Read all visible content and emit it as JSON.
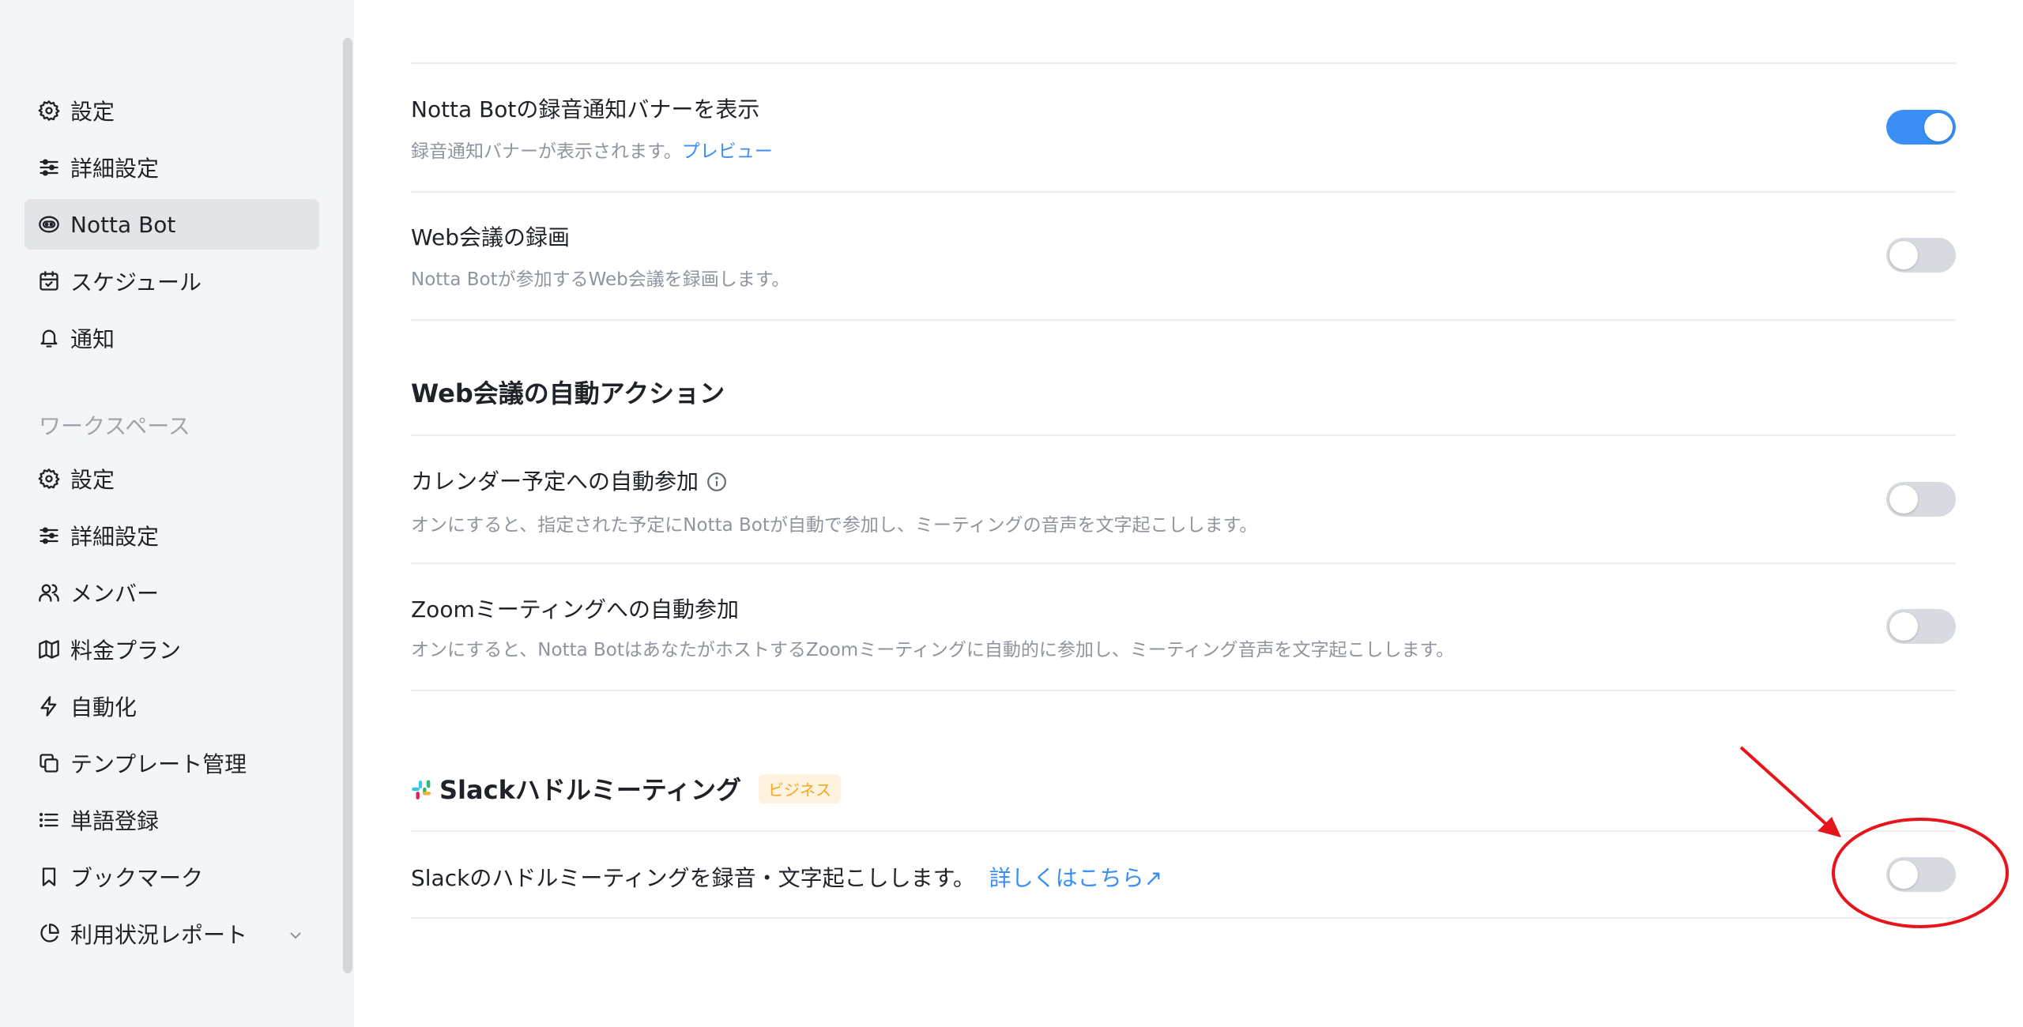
{
  "sidebar": {
    "personal_items": [
      {
        "label": "設定",
        "icon": "gear-icon"
      },
      {
        "label": "詳細設定",
        "icon": "sliders-icon"
      },
      {
        "label": "Notta Bot",
        "icon": "bot-icon",
        "active": true
      },
      {
        "label": "スケジュール",
        "icon": "calendar-icon"
      },
      {
        "label": "通知",
        "icon": "bell-icon"
      }
    ],
    "workspace_label": "ワークスペース",
    "workspace_items": [
      {
        "label": "設定",
        "icon": "gear-icon"
      },
      {
        "label": "詳細設定",
        "icon": "sliders-icon"
      },
      {
        "label": "メンバー",
        "icon": "users-icon"
      },
      {
        "label": "料金プラン",
        "icon": "map-icon"
      },
      {
        "label": "自動化",
        "icon": "lightning-icon"
      },
      {
        "label": "テンプレート管理",
        "icon": "copy-icon"
      },
      {
        "label": "単語登録",
        "icon": "list-icon"
      },
      {
        "label": "ブックマーク",
        "icon": "bookmark-icon"
      },
      {
        "label": "利用状況レポート",
        "icon": "pie-chart-icon",
        "expandable": true
      }
    ]
  },
  "main": {
    "banner_setting": {
      "title": "Notta Botの録音通知バナーを表示",
      "desc": "録音通知バナーが表示されます。",
      "link": "プレビュー",
      "enabled": true
    },
    "video_recording": {
      "title": "Web会議の録画",
      "desc": "Notta Botが参加するWeb会議を録画します。",
      "enabled": false
    },
    "auto_actions_title": "Web会議の自動アクション",
    "calendar_join": {
      "title": "カレンダー予定への自動参加",
      "desc": "オンにすると、指定された予定にNotta Botが自動で参加し、ミーティングの音声を文字起こしします。",
      "enabled": false
    },
    "zoom_join": {
      "title": "Zoomミーティングへの自動参加",
      "desc": "オンにすると、Notta BotはあなたがホストするZoomミーティングに自動的に参加し、ミーティング音声を文字起こしします。",
      "enabled": false
    },
    "slack": {
      "title": "Slackハドルミーティング",
      "badge": "ビジネス",
      "desc": "Slackのハドルミーティングを録音・文字起こしします。",
      "link": "詳しくはこちら↗",
      "enabled": false
    }
  },
  "colors": {
    "accent": "#3a8ef6",
    "annotation": "#e8141b",
    "badge_text": "#f5a623"
  }
}
